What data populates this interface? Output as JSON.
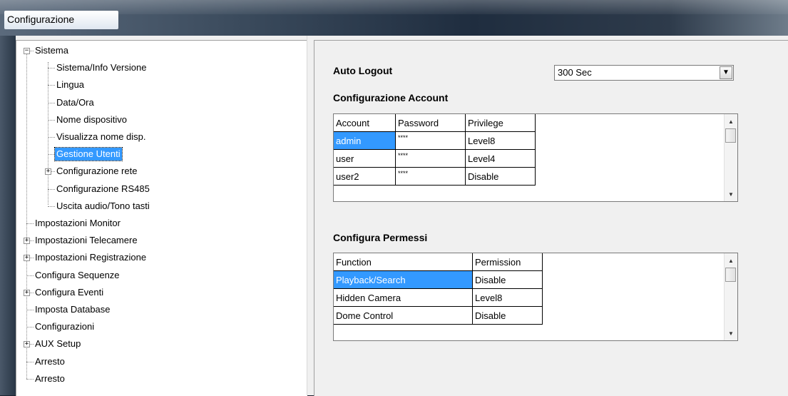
{
  "window": {
    "title": "Configurazione"
  },
  "tree": {
    "items": [
      {
        "label": "Sistema",
        "expander": "−"
      },
      {
        "label": "Sistema/Info Versione"
      },
      {
        "label": "Lingua"
      },
      {
        "label": "Data/Ora"
      },
      {
        "label": "Nome dispositivo"
      },
      {
        "label": "Visualizza nome disp."
      },
      {
        "label": "Gestione Utenti",
        "selected": true
      },
      {
        "label": "Configurazione rete",
        "expander": "+"
      },
      {
        "label": "Configurazione RS485"
      },
      {
        "label": "Uscita audio/Tono tasti"
      },
      {
        "label": "Impostazioni Monitor"
      },
      {
        "label": "Impostazioni Telecamere",
        "expander": "+"
      },
      {
        "label": "Impostazioni Registrazione",
        "expander": "+"
      },
      {
        "label": "Configura Sequenze"
      },
      {
        "label": "Configura Eventi",
        "expander": "+"
      },
      {
        "label": "Imposta Database"
      },
      {
        "label": "Configurazioni"
      },
      {
        "label": "AUX Setup",
        "expander": "+"
      },
      {
        "label": "Arresto"
      },
      {
        "label": "Arresto"
      }
    ]
  },
  "auto_logout": {
    "label": "Auto Logout",
    "value": "300 Sec"
  },
  "account": {
    "title": "Configurazione Account",
    "columns": [
      "Account",
      "Password",
      "Privilege"
    ],
    "rows": [
      {
        "account": "admin",
        "password": "****",
        "privilege": "Level8"
      },
      {
        "account": "user",
        "password": "****",
        "privilege": "Level4"
      },
      {
        "account": "user2",
        "password": "****",
        "privilege": "Disable"
      }
    ]
  },
  "permissions": {
    "title": "Configura Permessi",
    "columns": [
      "Function",
      "Permission"
    ],
    "rows": [
      {
        "function": "Playback/Search",
        "permission": "Disable"
      },
      {
        "function": "Hidden Camera",
        "permission": "Level8"
      },
      {
        "function": "Dome Control",
        "permission": "Disable"
      }
    ]
  },
  "colors": {
    "selection": "#3399ff",
    "panel": "#f0f0f0"
  },
  "icons": {
    "dropdown": "chevron-down-icon",
    "scroll_up": "scroll-up-icon",
    "scroll_down": "scroll-down-icon"
  }
}
